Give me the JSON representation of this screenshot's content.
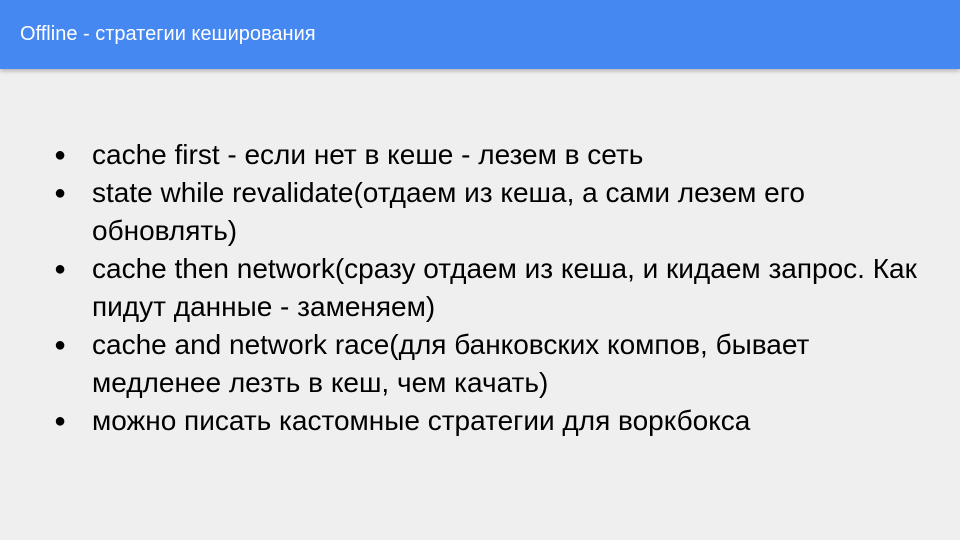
{
  "header": {
    "title": "Offline - стратегии кеширования"
  },
  "bullets": [
    "cache first - если нет в кеше - лезем в сеть",
    "state while revalidate(отдаем  из кеша, а сами лезем его обновлять)",
    "cache then network(сразу отдаем из кеша, и кидаем запрос. Как пидут данные - заменяем)",
    "cache and network race(для банковских компов, бывает медленее лезть в кеш, чем качать)",
    "можно писать кастомные стратегии для воркбокса"
  ],
  "colors": {
    "header_bg": "#4688f1",
    "slide_bg": "#efefef",
    "text": "#000000"
  }
}
